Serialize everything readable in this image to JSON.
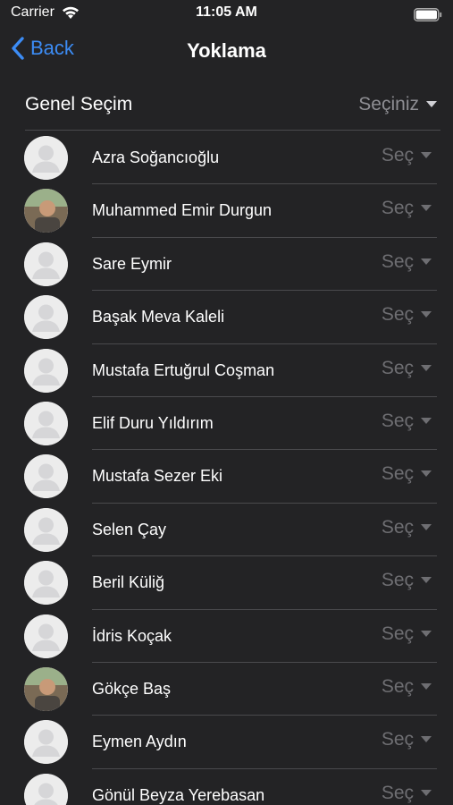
{
  "status_bar": {
    "carrier": "Carrier",
    "time": "11:05 AM"
  },
  "nav": {
    "back_label": "Back",
    "title": "Yoklama"
  },
  "general": {
    "label": "Genel Seçim",
    "select_label": "Seçiniz"
  },
  "students": [
    {
      "name": "Azra Soğancıoğlu",
      "status": "Seç",
      "avatar": "placeholder"
    },
    {
      "name": "Muhammed Emir Durgun",
      "status": "Seç",
      "avatar": "photo"
    },
    {
      "name": "Sare Eymir",
      "status": "Seç",
      "avatar": "placeholder"
    },
    {
      "name": "Başak Meva Kaleli",
      "status": "Seç",
      "avatar": "placeholder"
    },
    {
      "name": "Mustafa Ertuğrul Coşman",
      "status": "Seç",
      "avatar": "placeholder"
    },
    {
      "name": "Elif Duru Yıldırım",
      "status": "Seç",
      "avatar": "placeholder"
    },
    {
      "name": "Mustafa Sezer Eki",
      "status": "Seç",
      "avatar": "placeholder"
    },
    {
      "name": "Selen Çay",
      "status": "Seç",
      "avatar": "placeholder"
    },
    {
      "name": "Beril Küliğ",
      "status": "Seç",
      "avatar": "placeholder"
    },
    {
      "name": "İdris Koçak",
      "status": "Seç",
      "avatar": "placeholder"
    },
    {
      "name": "Gökçe Baş",
      "status": "Seç",
      "avatar": "photo"
    },
    {
      "name": "Eymen Aydın",
      "status": "Seç",
      "avatar": "placeholder"
    },
    {
      "name": "Gönül Beyza Yerebasan",
      "status": "Seç",
      "avatar": "placeholder"
    }
  ],
  "colors": {
    "background": "#232325",
    "accent": "#3c8cf5",
    "muted_text": "#8e8e93",
    "divider": "#4a4a4d"
  }
}
